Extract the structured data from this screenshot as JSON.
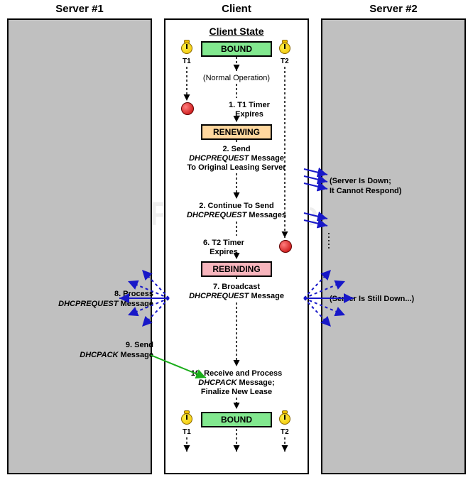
{
  "watermark": "The TCP/IP Guide",
  "headers": {
    "left": "Server #1",
    "mid": "Client",
    "right": "Server #2"
  },
  "clientTitle": "Client State",
  "states": {
    "bound": "BOUND",
    "renew": "RENEWING",
    "rebind": "REBINDING"
  },
  "timers": {
    "t1": "T1",
    "t2": "T2"
  },
  "captions": {
    "normal": "(Normal Operation)",
    "s1a": "1. T1 Timer",
    "s1b": "Expires",
    "s2a": "2. Send",
    "s2b": "DHCPREQUEST",
    "s2c": " Message",
    "s2d": "To Original Leasing Server",
    "s22a": "2. Continue To Send",
    "s22b": "DHCPREQUEST",
    "s22c": " Messages",
    "s6a": "6. T2 Timer",
    "s6b": "Expires",
    "s7a": "7. Broadcast",
    "s7b": "DHCPREQUEST",
    "s7c": " Message",
    "s10a": "10. Receive and Process",
    "s10b": "DHCPACK",
    "s10c": " Message;",
    "s10d": "Finalize New Lease"
  },
  "side": {
    "srvDownA": "(Server Is Down;",
    "srvDownB": "It Cannot Respond)",
    "stillDown": "(Server Is Still Down...)",
    "s8a": "8. Process",
    "s8b": "DHCPREQUEST",
    "s8c": " Message",
    "s9a": "9. Send",
    "s9b": "DHCPACK",
    "s9c": " Message"
  }
}
